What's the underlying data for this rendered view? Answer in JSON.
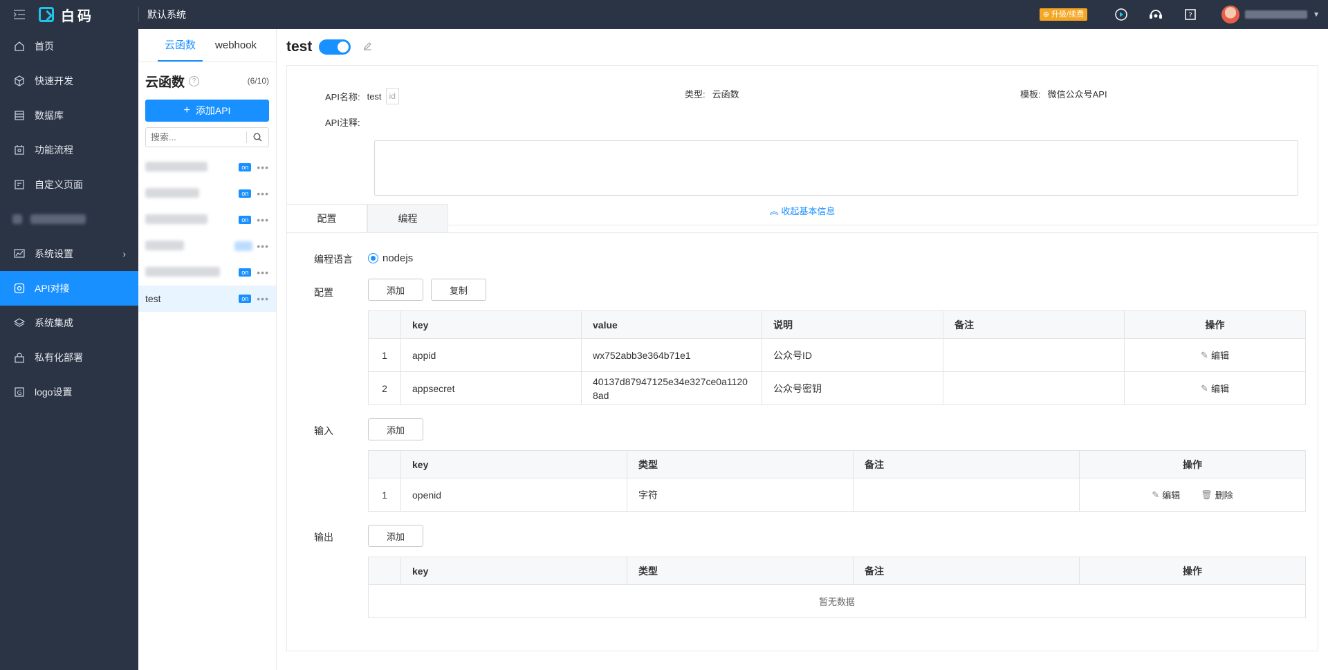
{
  "topbar": {
    "brand": "白码",
    "system_name": "默认系统",
    "upgrade_label": "升级/续费"
  },
  "sidebar": {
    "items": [
      {
        "label": "首页",
        "icon": "home-icon"
      },
      {
        "label": "快速开发",
        "icon": "cube-icon"
      },
      {
        "label": "数据库",
        "icon": "database-icon"
      },
      {
        "label": "功能流程",
        "icon": "flow-icon"
      },
      {
        "label": "自定义页面",
        "icon": "page-icon"
      },
      {
        "label": "",
        "icon": "blurred-icon"
      },
      {
        "label": "系统设置",
        "icon": "chart-icon"
      },
      {
        "label": "API对接",
        "icon": "api-icon"
      },
      {
        "label": "系统集成",
        "icon": "layers-icon"
      },
      {
        "label": "私有化部署",
        "icon": "lock-icon"
      },
      {
        "label": "logo设置",
        "icon": "logo-icon"
      }
    ]
  },
  "listpanel": {
    "tabs": [
      "云函数",
      "webhook"
    ],
    "title": "云函数",
    "count": "(6/10)",
    "add_label": "添加API",
    "search_placeholder": "搜索...",
    "badge": "on",
    "active_item": "test"
  },
  "main": {
    "api_name": "test",
    "info": {
      "name_label": "API名称:",
      "name_value": "test",
      "id_tag": "id",
      "type_label": "类型:",
      "type_value": "云函数",
      "template_label": "模板:",
      "template_value": "微信公众号API",
      "note_label": "API注释:",
      "collapse_label": "收起基本信息"
    },
    "tabs": [
      "配置",
      "编程"
    ],
    "lang_label": "编程语言",
    "lang_value": "nodejs",
    "config": {
      "label": "配置",
      "add": "添加",
      "copy": "复制",
      "headers": [
        "key",
        "value",
        "说明",
        "备注",
        "操作"
      ],
      "rows": [
        {
          "idx": "1",
          "key": "appid",
          "value": "wx752abb3e364b71e1",
          "desc": "公众号ID",
          "note": "",
          "edit": "编辑"
        },
        {
          "idx": "2",
          "key": "appsecret",
          "value": "40137d87947125e34e327ce0a11208ad",
          "desc": "公众号密钥",
          "note": "",
          "edit": "编辑"
        }
      ]
    },
    "input": {
      "label": "输入",
      "add": "添加",
      "headers": [
        "key",
        "类型",
        "备注",
        "操作"
      ],
      "rows": [
        {
          "idx": "1",
          "key": "openid",
          "type": "字符",
          "note": "",
          "edit": "编辑",
          "delete": "删除"
        }
      ]
    },
    "output": {
      "label": "输出",
      "add": "添加",
      "headers": [
        "key",
        "类型",
        "备注",
        "操作"
      ],
      "empty": "暂无数据"
    }
  },
  "colors": {
    "primary": "#1890ff",
    "sidebar_bg": "#2b3445",
    "upgrade": "#f5a623"
  }
}
